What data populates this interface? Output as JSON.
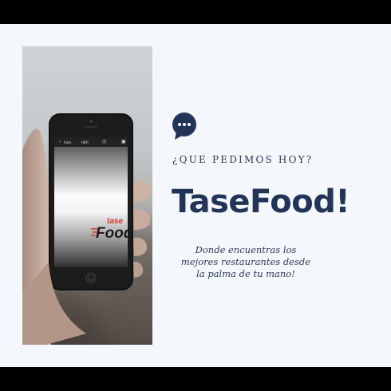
{
  "header": {
    "tagline": "¿QUE PEDIMOS HOY?"
  },
  "brand": {
    "name": "TaseFood!"
  },
  "description": {
    "lines": [
      "Donde encuentras los",
      "mejores restaurantes desde",
      "la palma de tu mano!"
    ]
  },
  "phone": {
    "logo_top": "tase",
    "logo_bottom": "Food",
    "status_auto": "Auto",
    "status_hdr": "HDR"
  },
  "icons": {
    "chat": "chat-bubble-icon",
    "camera": "camera-icon",
    "timer": "timer-icon",
    "flash": "flash-icon"
  },
  "colors": {
    "navy": "#223457",
    "background": "#f4f8fc",
    "frame": "#000000",
    "logo_red": "#d6392f"
  }
}
